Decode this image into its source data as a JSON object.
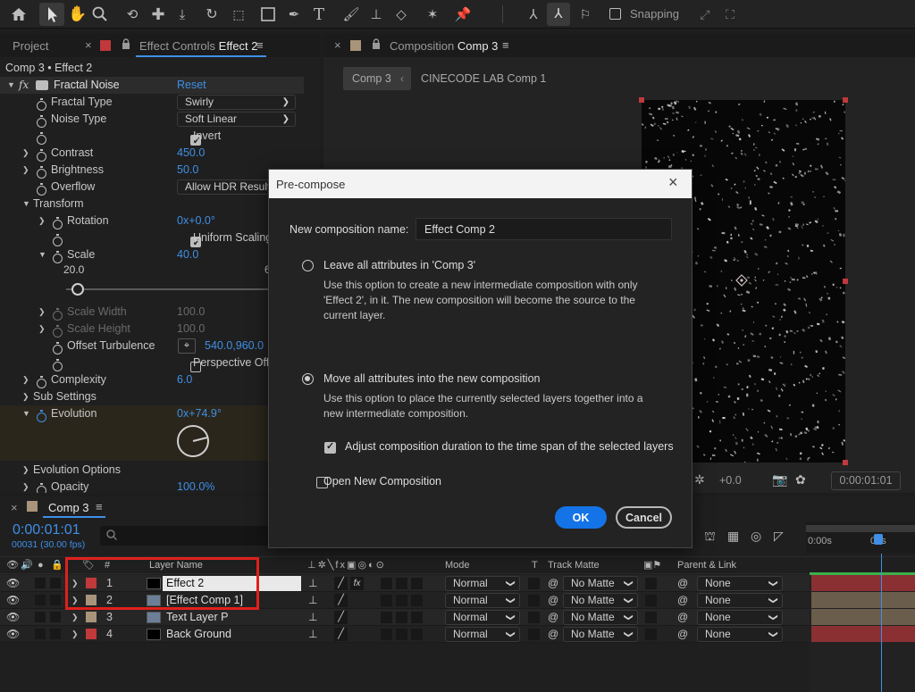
{
  "toolbar": {
    "snapping_label": "Snapping"
  },
  "project_panel": {
    "tab_label": "Project"
  },
  "effect_controls": {
    "tab_prefix": "Effect Controls",
    "tab_layer": "Effect 2",
    "breadcrumb": "Comp 3 • Effect 2",
    "effect_name": "Fractal Noise",
    "reset_label": "Reset",
    "props": {
      "fractal_type": {
        "label": "Fractal Type",
        "value": "Swirly"
      },
      "noise_type": {
        "label": "Noise Type",
        "value": "Soft Linear"
      },
      "invert": {
        "label": "Invert"
      },
      "contrast": {
        "label": "Contrast",
        "value": "450.0"
      },
      "brightness": {
        "label": "Brightness",
        "value": "50.0"
      },
      "overflow": {
        "label": "Overflow",
        "value": "Allow HDR Results"
      },
      "transform": {
        "label": "Transform"
      },
      "rotation": {
        "label": "Rotation",
        "value_a": "0x",
        "value_b": "+0.0°"
      },
      "uniform_scaling": {
        "label": "Uniform Scaling"
      },
      "scale": {
        "label": "Scale",
        "value": "40.0",
        "slider_min": "20.0",
        "slider_max": "6"
      },
      "scale_width": {
        "label": "Scale Width",
        "value": "100.0"
      },
      "scale_height": {
        "label": "Scale Height",
        "value": "100.0"
      },
      "offset_turbulence": {
        "label": "Offset Turbulence",
        "value": "540.0,960.0"
      },
      "perspective_offset": {
        "label": "Perspective Offs"
      },
      "complexity": {
        "label": "Complexity",
        "value": "6.0"
      },
      "sub_settings": {
        "label": "Sub Settings"
      },
      "evolution": {
        "label": "Evolution",
        "value_a": "0x",
        "value_b": "+74.9°"
      },
      "evolution_options": {
        "label": "Evolution Options"
      },
      "opacity": {
        "label": "Opacity",
        "value": "100.0%"
      }
    }
  },
  "composition_panel": {
    "tab_prefix": "Composition",
    "tab_comp": "Comp 3",
    "crumb_1": "Comp 3",
    "crumb_2": "CINECODE LAB Comp 1",
    "exposure_value": "+0.0",
    "time_readout": "0:00:01:01"
  },
  "timeline": {
    "tab_label": "Comp 3",
    "timecode": "0:00:01:01",
    "frame_info": "00031 (30.00 fps)",
    "search_placeholder": "",
    "ruler_start": "0:00s",
    "ruler_mark": "01s",
    "columns": {
      "hash": "#",
      "layer_name": "Layer Name",
      "mode": "Mode",
      "t": "T",
      "track_matte": "Track Matte",
      "parent": "Parent & Link"
    },
    "layers": [
      {
        "num": "1",
        "name": "Effect 2",
        "mode": "Normal",
        "matte": "No Matte",
        "parent": "None",
        "color": "#c0393b"
      },
      {
        "num": "2",
        "name": "[Effect Comp 1]",
        "mode": "Normal",
        "matte": "No Matte",
        "parent": "None",
        "color": "#a8947a"
      },
      {
        "num": "3",
        "name": "Text Layer P",
        "mode": "Normal",
        "matte": "No Matte",
        "parent": "None",
        "color": "#a8947a"
      },
      {
        "num": "4",
        "name": "Back Ground",
        "mode": "Normal",
        "matte": "No Matte",
        "parent": "None",
        "color": "#c0393b"
      }
    ]
  },
  "dialog": {
    "title": "Pre-compose",
    "name_label": "New composition name:",
    "name_value": "Effect Comp 2",
    "option1_label": "Leave all attributes in 'Comp 3'",
    "option1_desc": "Use this option to create a new intermediate composition with only 'Effect 2', in it. The new composition will become the source to the current layer.",
    "option2_label": "Move all attributes into the new composition",
    "option2_desc": "Use this option to place the currently selected layers together into a new intermediate composition.",
    "adjust_label": "Adjust composition duration to the time span of the selected layers",
    "open_label": "Open New Composition",
    "ok_label": "OK",
    "cancel_label": "Cancel"
  },
  "colors": {
    "accent": "#1473e6",
    "highlight_box": "#e0201c",
    "link_blue": "#3f8fe6"
  }
}
